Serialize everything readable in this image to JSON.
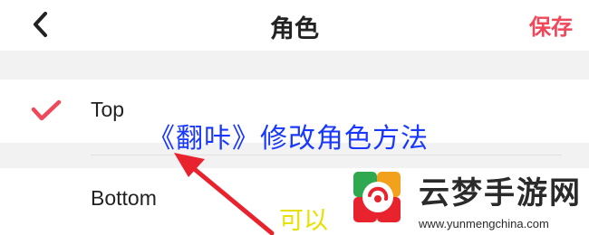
{
  "header": {
    "title": "角色",
    "save_label": "保存"
  },
  "options": [
    {
      "label": "Top",
      "selected": true
    },
    {
      "label": "Bottom",
      "selected": false
    }
  ],
  "overlay": {
    "caption": "《翻咔》修改角色方法",
    "sub_text": "可以"
  },
  "watermark": {
    "name": "云梦手游网",
    "url": "www.yunmengchina.com"
  },
  "colors": {
    "accent": "#f0485b",
    "caption": "#1838ff",
    "arrow": "#e8232e"
  }
}
